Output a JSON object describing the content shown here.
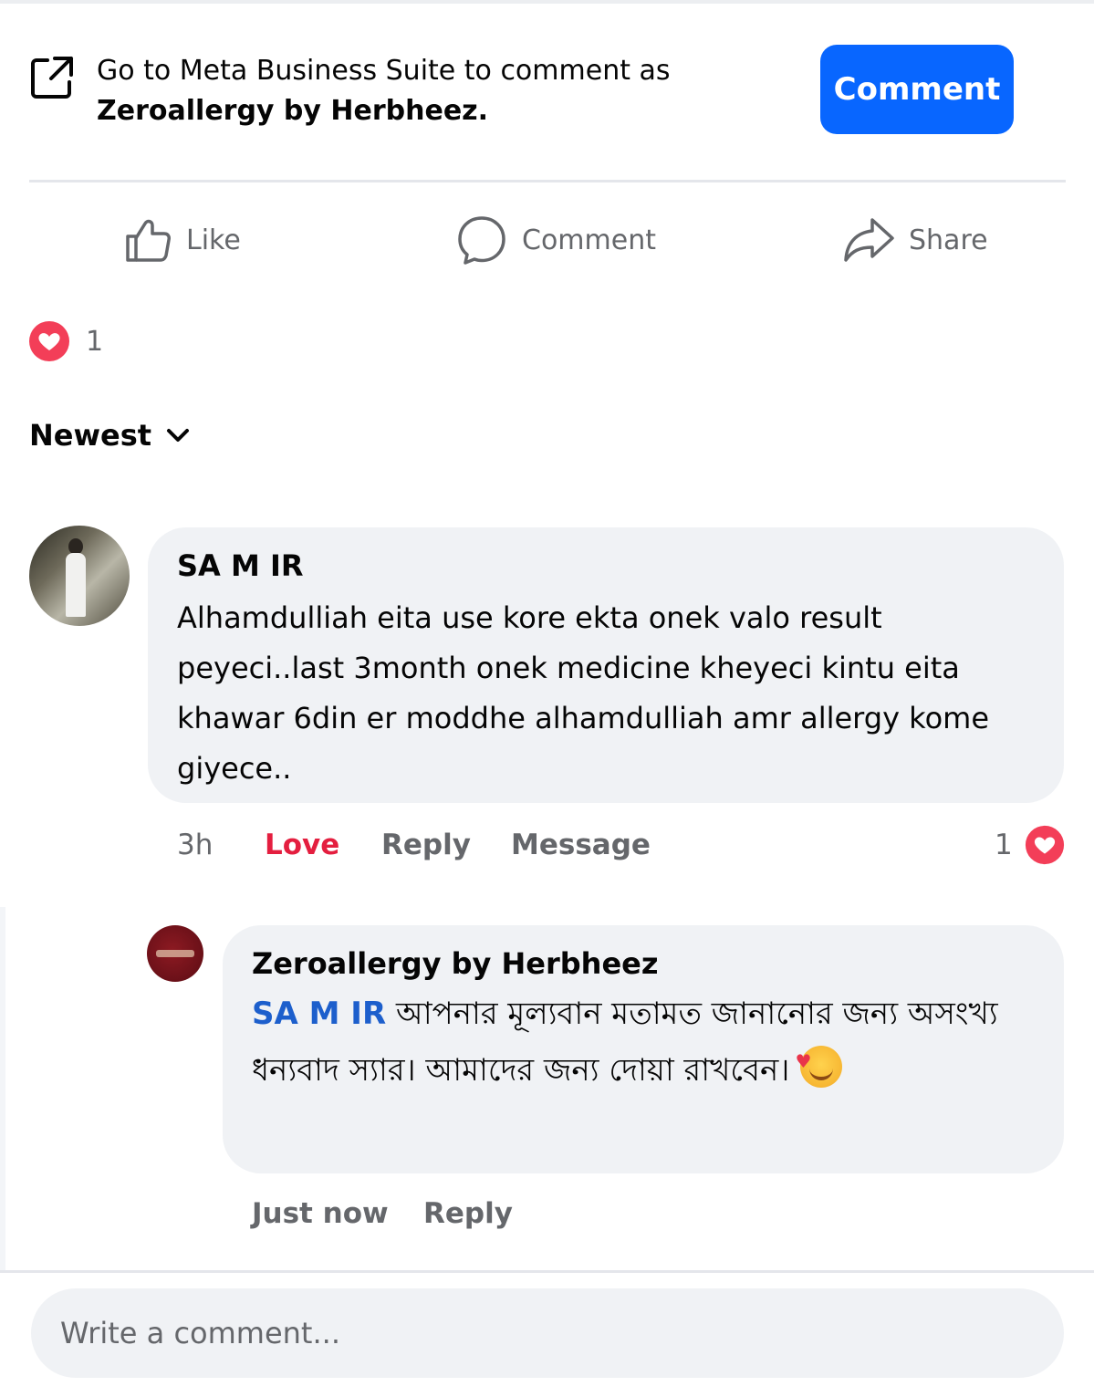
{
  "banner": {
    "line1": "Go to Meta Business Suite to comment as",
    "line2": "Zeroallergy by Herbheez.",
    "button_label": "Comment",
    "icon": "external-link-icon"
  },
  "actions": [
    {
      "label": "Like",
      "icon": "thumbs-up-icon"
    },
    {
      "label": "Comment",
      "icon": "comment-bubble-icon"
    },
    {
      "label": "Share",
      "icon": "share-arrow-icon"
    }
  ],
  "reactions": {
    "count": "1",
    "icon": "love-reaction-icon"
  },
  "sort": {
    "label": "Newest",
    "icon": "chevron-down-icon"
  },
  "comments": [
    {
      "author": "SA M IR",
      "text": "Alhamdulliah eita use kore ekta onek valo result peyeci..last 3month onek medicine kheyeci kintu eita khawar 6din er moddhe alhamdulliah amr allergy kome giyece..",
      "time": "3h",
      "love": "Love",
      "reply": "Reply",
      "message": "Message",
      "reaction_count": "1"
    }
  ],
  "reply_comment": {
    "author": "Zeroallergy by Herbheez",
    "mention": "SA M IR",
    "text": "আপনার মূল্যবান মতামত জানানোর জন্য অসংখ্য ধন্যবাদ স্যার। আমাদের জন্য দোয়া রাখবেন।",
    "emoji": "smiling-face-with-hearts-icon",
    "time": "Just now",
    "reply": "Reply"
  },
  "composer": {
    "placeholder": "Write a comment..."
  },
  "colors": {
    "primary_blue": "#0866ff",
    "love_red": "#e41e3f",
    "bubble_gray": "#f0f2f5",
    "muted_text": "#65676b"
  }
}
